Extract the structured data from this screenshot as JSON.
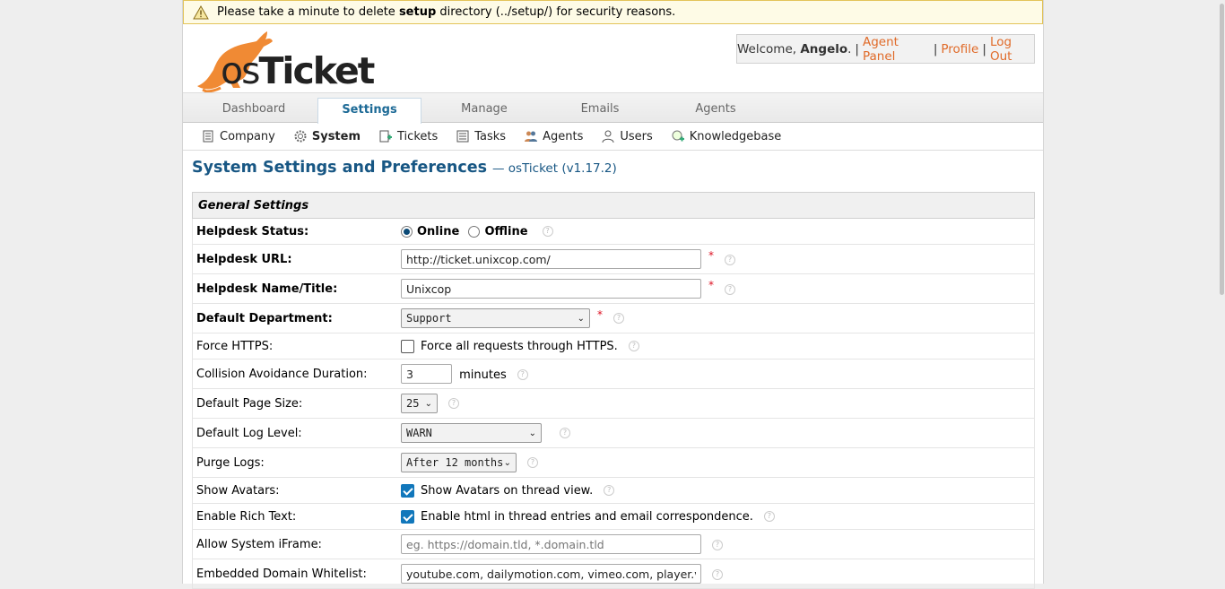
{
  "warning": {
    "prefix": "Please take a minute to delete ",
    "strong": "setup",
    "suffix": " directory (../setup/) for security reasons."
  },
  "user": {
    "welcome": "Welcome, ",
    "name": "Angelo",
    "after_name": ".",
    "agent_panel": "Agent Panel",
    "profile": "Profile",
    "logout": "Log Out"
  },
  "tabs": [
    "Dashboard",
    "Settings",
    "Manage",
    "Emails",
    "Agents"
  ],
  "subnav": [
    "Company",
    "System",
    "Tickets",
    "Tasks",
    "Agents",
    "Users",
    "Knowledgebase"
  ],
  "page": {
    "title": "System Settings and Preferences",
    "version": "— osTicket (v1.17.2)"
  },
  "section_header": "General Settings",
  "rows": {
    "status": {
      "label": "Helpdesk Status:",
      "online": "Online",
      "offline": "Offline"
    },
    "url": {
      "label": "Helpdesk URL:",
      "value": "http://ticket.unixcop.com/"
    },
    "name": {
      "label": "Helpdesk Name/Title:",
      "value": "Unixcop"
    },
    "dept": {
      "label": "Default Department:",
      "value": "Support"
    },
    "https": {
      "label": "Force HTTPS:",
      "text": "Force all requests through HTTPS."
    },
    "collision": {
      "label": "Collision Avoidance Duration:",
      "value": "3",
      "unit": "minutes"
    },
    "pagesize": {
      "label": "Default Page Size:",
      "value": "25"
    },
    "loglevel": {
      "label": "Default Log Level:",
      "value": "WARN"
    },
    "purge": {
      "label": "Purge Logs:",
      "value": "After 12 months"
    },
    "avatars": {
      "label": "Show Avatars:",
      "text": "Show Avatars on thread view."
    },
    "richtext": {
      "label": "Enable Rich Text:",
      "text": "Enable html in thread entries and email correspondence."
    },
    "iframe": {
      "label": "Allow System iFrame:",
      "placeholder": "eg. https://domain.tld, *.domain.tld"
    },
    "whitelist": {
      "label": "Embedded Domain Whitelist:",
      "value": "youtube.com, dailymotion.com, vimeo.com, player.vimeo.com"
    }
  },
  "colors": {
    "accent": "#185784",
    "link": "#e06a28",
    "warn_bg": "#fefbe6"
  }
}
